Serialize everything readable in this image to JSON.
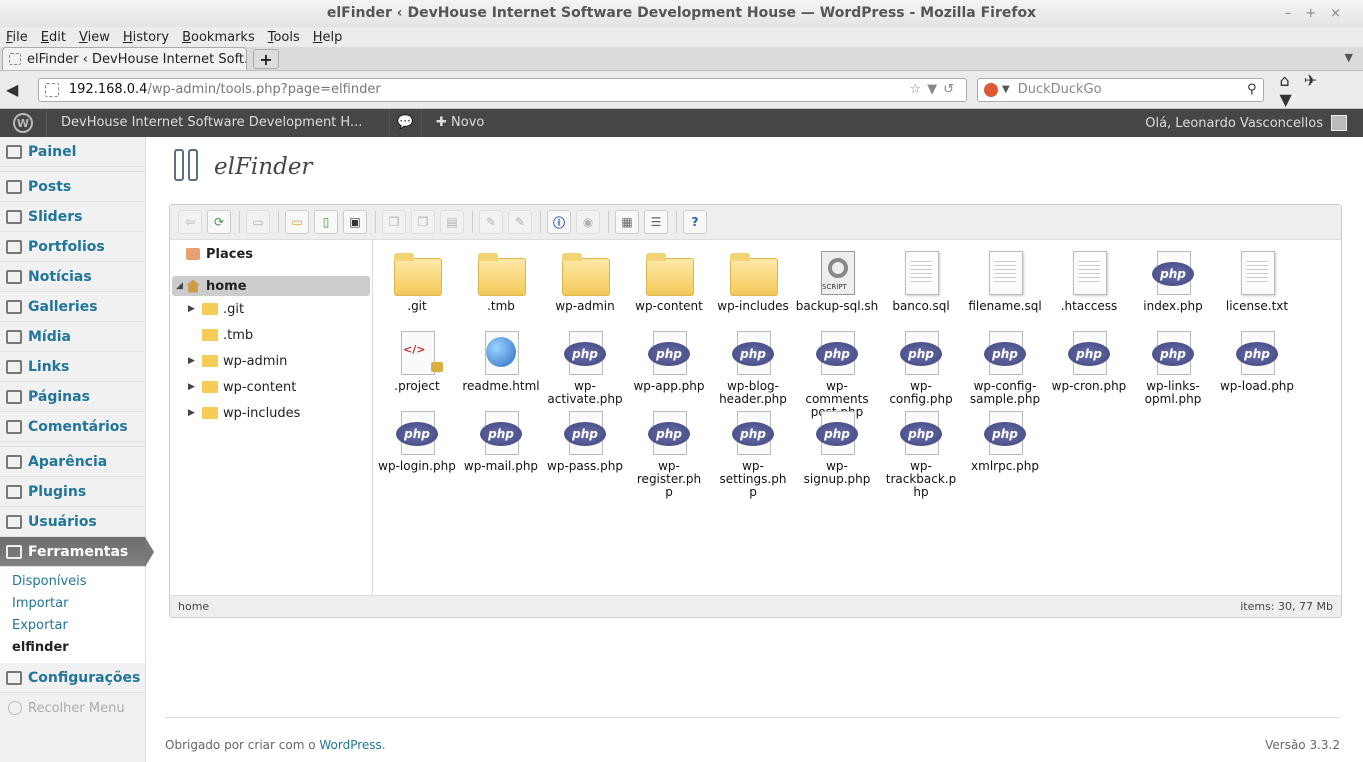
{
  "window": {
    "title": "elFinder ‹ DevHouse Internet Software Development House — WordPress - Mozilla Firefox"
  },
  "menubar": [
    {
      "label": "File",
      "key": "F",
      "rest": "ile"
    },
    {
      "label": "Edit",
      "key": "E",
      "rest": "dit"
    },
    {
      "label": "View",
      "key": "V",
      "rest": "iew"
    },
    {
      "label": "History",
      "key": "H",
      "rest": "istory"
    },
    {
      "label": "Bookmarks",
      "key": "B",
      "rest": "ookmarks"
    },
    {
      "label": "Tools",
      "key": "T",
      "rest": "ools"
    },
    {
      "label": "Help",
      "key": "H",
      "rest": "elp"
    }
  ],
  "tab": {
    "label": "elFinder ‹ DevHouse Internet Soft..."
  },
  "url": {
    "host": "192.168.0.4",
    "path": "/wp-admin/tools.php?page=elfinder"
  },
  "search": {
    "placeholder": "DuckDuckGo"
  },
  "adminbar": {
    "site": "DevHouse Internet Software Development H...",
    "new": "Novo",
    "howdy": "Olá, Leonardo Vasconcellos"
  },
  "sidebar": {
    "group1": [
      "Painel"
    ],
    "group2": [
      "Posts",
      "Sliders",
      "Portfolios",
      "Notícias",
      "Galleries",
      "Mídia",
      "Links",
      "Páginas",
      "Comentários"
    ],
    "group3": [
      "Aparência",
      "Plugins",
      "Usuários"
    ],
    "current": "Ferramentas",
    "submenu": [
      "Disponíveis",
      "Importar",
      "Exportar",
      "elfinder"
    ],
    "active_sub": 3,
    "settings": "Configurações",
    "collapse": "Recolher Menu"
  },
  "page": {
    "title": "elFinder"
  },
  "elfinder": {
    "places": "Places",
    "home": "home",
    "tree": [
      {
        "name": ".git",
        "has_children": true
      },
      {
        "name": ".tmb",
        "has_children": false
      },
      {
        "name": "wp-admin",
        "has_children": true
      },
      {
        "name": "wp-content",
        "has_children": true
      },
      {
        "name": "wp-includes",
        "has_children": true
      }
    ],
    "files": [
      {
        "name": ".git",
        "kind": "folder"
      },
      {
        "name": ".tmb",
        "kind": "folder"
      },
      {
        "name": "wp-admin",
        "kind": "folder"
      },
      {
        "name": "wp-content",
        "kind": "folder"
      },
      {
        "name": "wp-includes",
        "kind": "folder"
      },
      {
        "name": "backup-sql.sh",
        "kind": "script"
      },
      {
        "name": "banco.sql",
        "kind": "doc"
      },
      {
        "name": "filename.sql",
        "kind": "doc"
      },
      {
        "name": ".htaccess",
        "kind": "doc"
      },
      {
        "name": "index.php",
        "kind": "php"
      },
      {
        "name": "license.txt",
        "kind": "doc"
      },
      {
        "name": ".project",
        "kind": "code"
      },
      {
        "name": "readme.html",
        "kind": "html"
      },
      {
        "name": "wp-activate.php",
        "kind": "php"
      },
      {
        "name": "wp-app.php",
        "kind": "php"
      },
      {
        "name": "wp-blog-header.php",
        "kind": "php"
      },
      {
        "name": "wp-comments-post.php",
        "kind": "php"
      },
      {
        "name": "wp-config.php",
        "kind": "php"
      },
      {
        "name": "wp-config-sample.php",
        "kind": "php"
      },
      {
        "name": "wp-cron.php",
        "kind": "php"
      },
      {
        "name": "wp-links-opml.php",
        "kind": "php"
      },
      {
        "name": "wp-load.php",
        "kind": "php"
      },
      {
        "name": "wp-login.php",
        "kind": "php"
      },
      {
        "name": "wp-mail.php",
        "kind": "php"
      },
      {
        "name": "wp-pass.php",
        "kind": "php"
      },
      {
        "name": "wp-register.php",
        "kind": "php"
      },
      {
        "name": "wp-settings.php",
        "kind": "php"
      },
      {
        "name": "wp-signup.php",
        "kind": "php"
      },
      {
        "name": "wp-trackback.php",
        "kind": "php"
      },
      {
        "name": "xmlrpc.php",
        "kind": "php"
      }
    ],
    "file_labels": [
      ".git",
      ".tmb",
      "wp-admin",
      "wp-content",
      "wp-includes",
      "backup-sql.sh",
      "banco.sql",
      "filename.sql",
      ".htaccess",
      "index.php",
      "license.txt",
      ".project",
      "readme.html",
      "wp-activate.php",
      "wp-app.php",
      "wp-blog-\nheader.php",
      "wp-comments\npost.php",
      "wp-config.php",
      "wp-config-\nsample.php",
      "wp-cron.php",
      "wp-links-\nopml.php",
      "wp-load.php",
      "wp-login.php",
      "wp-mail.php",
      "wp-pass.php",
      "wp-register.ph\np",
      "wp-settings.ph\np",
      "wp-signup.php",
      "wp-trackback.p\nhp",
      "xmlrpc.php"
    ],
    "status_path": "home",
    "status_info": "items: 30, 77 Mb"
  },
  "footer": {
    "text": "Obrigado por criar com o ",
    "link": "WordPress",
    "suffix": ".",
    "version": "Versão 3.3.2"
  }
}
